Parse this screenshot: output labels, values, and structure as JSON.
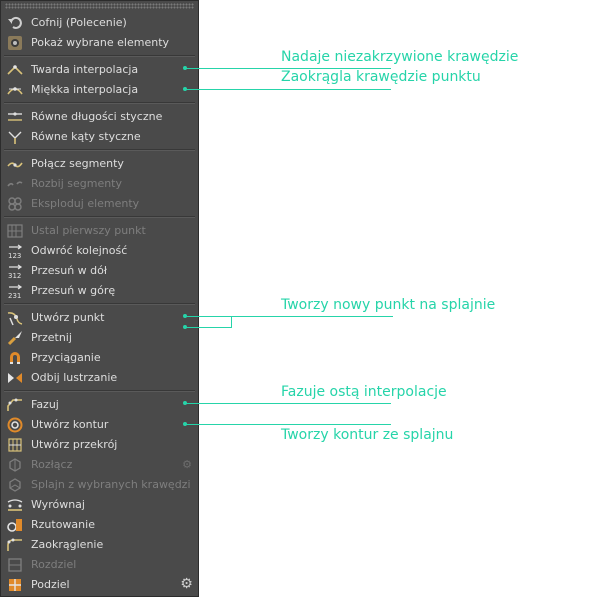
{
  "menu": {
    "items": [
      {
        "label": "Cofnij (Polecenie)",
        "icon": "undo-icon",
        "enabled": true
      },
      {
        "label": "Pokaż wybrane elementy",
        "icon": "frame-selected-icon",
        "enabled": true
      },
      {
        "label": "Twarda interpolacja",
        "icon": "hard-interpolation-icon",
        "enabled": true
      },
      {
        "label": "Miękka interpolacja",
        "icon": "soft-interpolation-icon",
        "enabled": true
      },
      {
        "label": "Równe długości styczne",
        "icon": "equal-tangent-length-icon",
        "enabled": true
      },
      {
        "label": "Równe kąty styczne",
        "icon": "equal-tangent-direction-icon",
        "enabled": true
      },
      {
        "label": "Połącz segmenty",
        "icon": "join-segment-icon",
        "enabled": true
      },
      {
        "label": "Rozbij segmenty",
        "icon": "break-segment-icon",
        "enabled": false
      },
      {
        "label": "Eksploduj elementy",
        "icon": "explode-segments-icon",
        "enabled": false
      },
      {
        "label": "Ustal pierwszy punkt",
        "icon": "set-first-point-icon",
        "enabled": false
      },
      {
        "label": "Odwróć kolejność",
        "icon": "reverse-sequence-icon",
        "enabled": true
      },
      {
        "label": "Przesuń w dół",
        "icon": "move-down-sequence-icon",
        "enabled": true
      },
      {
        "label": "Przesuń w górę",
        "icon": "move-up-sequence-icon",
        "enabled": true
      },
      {
        "label": "Utwórz punkt",
        "icon": "create-point-icon",
        "enabled": true
      },
      {
        "label": "Przetnij",
        "icon": "knife-icon",
        "enabled": true
      },
      {
        "label": "Przyciąganie",
        "icon": "magnet-icon",
        "enabled": true
      },
      {
        "label": "Odbij lustrzanie",
        "icon": "mirror-icon",
        "enabled": true
      },
      {
        "label": "Fazuj",
        "icon": "chamfer-icon",
        "enabled": true
      },
      {
        "label": "Utwórz kontur",
        "icon": "create-outline-icon",
        "enabled": true
      },
      {
        "label": "Utwórz przekrój",
        "icon": "cross-section-icon",
        "enabled": true
      },
      {
        "label": "Rozłącz",
        "icon": "disconnect-icon",
        "enabled": false
      },
      {
        "label": "Splajn z wybranych krawędzi",
        "icon": "edge-to-spline-icon",
        "enabled": false
      },
      {
        "label": "Wyrównaj",
        "icon": "line-up-icon",
        "enabled": true
      },
      {
        "label": "Rzutowanie",
        "icon": "project-icon",
        "enabled": true
      },
      {
        "label": "Zaokrąglenie",
        "icon": "round-icon",
        "enabled": true
      },
      {
        "label": "Rozdziel",
        "icon": "split-icon",
        "enabled": false
      },
      {
        "label": "Podziel",
        "icon": "subdivide-icon",
        "enabled": true
      }
    ],
    "gear_icon": "gear-icon",
    "accent": "#26d4a9"
  },
  "annotations": [
    {
      "text": "Nadaje niezakrzywione krawędzie"
    },
    {
      "text": "Zaokrągla krawędzie punktu"
    },
    {
      "text": "Tworzy nowy punkt na splajnie"
    },
    {
      "text": "Fazuje ostą interpolacje"
    },
    {
      "text": "Tworzy kontur ze splajnu"
    }
  ]
}
